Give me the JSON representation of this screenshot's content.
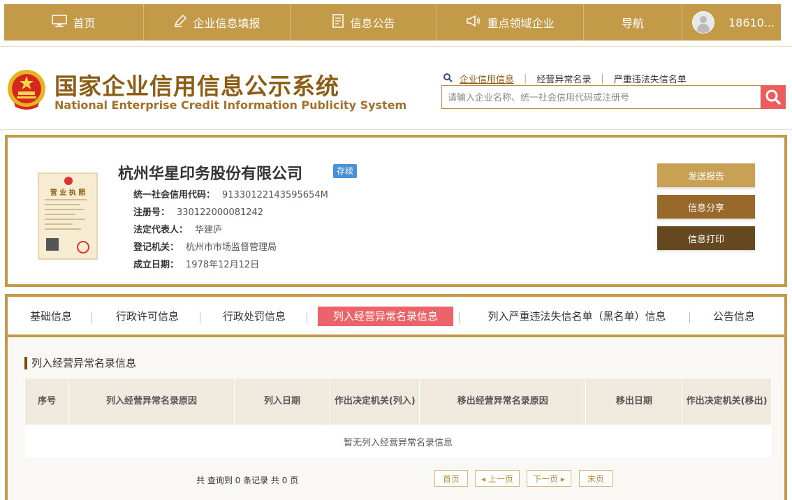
{
  "topnav": {
    "items": [
      {
        "label": "首页",
        "icon": "monitor-icon"
      },
      {
        "label": "企业信息填报",
        "icon": "pen-icon"
      },
      {
        "label": "信息公告",
        "icon": "document-icon"
      },
      {
        "label": "重点领域企业",
        "icon": "megaphone-icon"
      },
      {
        "label": "导航"
      }
    ],
    "user": "18610..."
  },
  "header": {
    "title_cn": "国家企业信用信息公示系统",
    "title_en": "National Enterprise Credit Information Publicity System",
    "search_links": [
      "企业信用信息",
      "经营异常名录",
      "严重违法失信名单"
    ],
    "search_placeholder": "请输入企业名称、统一社会信用代码或注册号"
  },
  "company": {
    "license_title": "营 业 执 照",
    "name": "杭州华星印务股份有限公司",
    "status": "存续",
    "fields": [
      {
        "label": "统一社会信用代码：",
        "value": "91330122143595654M"
      },
      {
        "label": "注册号：",
        "value": "330122000081242"
      },
      {
        "label": "法定代表人：",
        "value": "华建庐"
      },
      {
        "label": "登记机关：",
        "value": "杭州市市场监督管理局"
      },
      {
        "label": "成立日期：",
        "value": "1978年12月12日"
      }
    ],
    "buttons": {
      "report": "发送报告",
      "share": "信息分享",
      "print": "信息打印"
    }
  },
  "tabs": [
    "基础信息",
    "行政许可信息",
    "行政处罚信息",
    "列入经营异常名录信息",
    "列入严重违法失信名单（黑名单）信息",
    "公告信息"
  ],
  "section": {
    "title": "列入经营异常名录信息",
    "columns": [
      "序号",
      "列入经营异常名录原因",
      "列入日期",
      "作出决定机关(列入)",
      "移出经营异常名录原因",
      "移出日期",
      "作出决定机关(移出)"
    ],
    "empty": "暂无列入经营异常名录信息",
    "pager_info": "共 查询到 0 条记录 共 0 页",
    "pager": {
      "first": "首页",
      "prev": "上一页",
      "next": "下一页",
      "last": "末页"
    }
  },
  "colors": {
    "brand": "#c39a48",
    "active_tab": "#ec6469",
    "search_btn": "#ec5d5d",
    "status": "#4a90d9"
  }
}
